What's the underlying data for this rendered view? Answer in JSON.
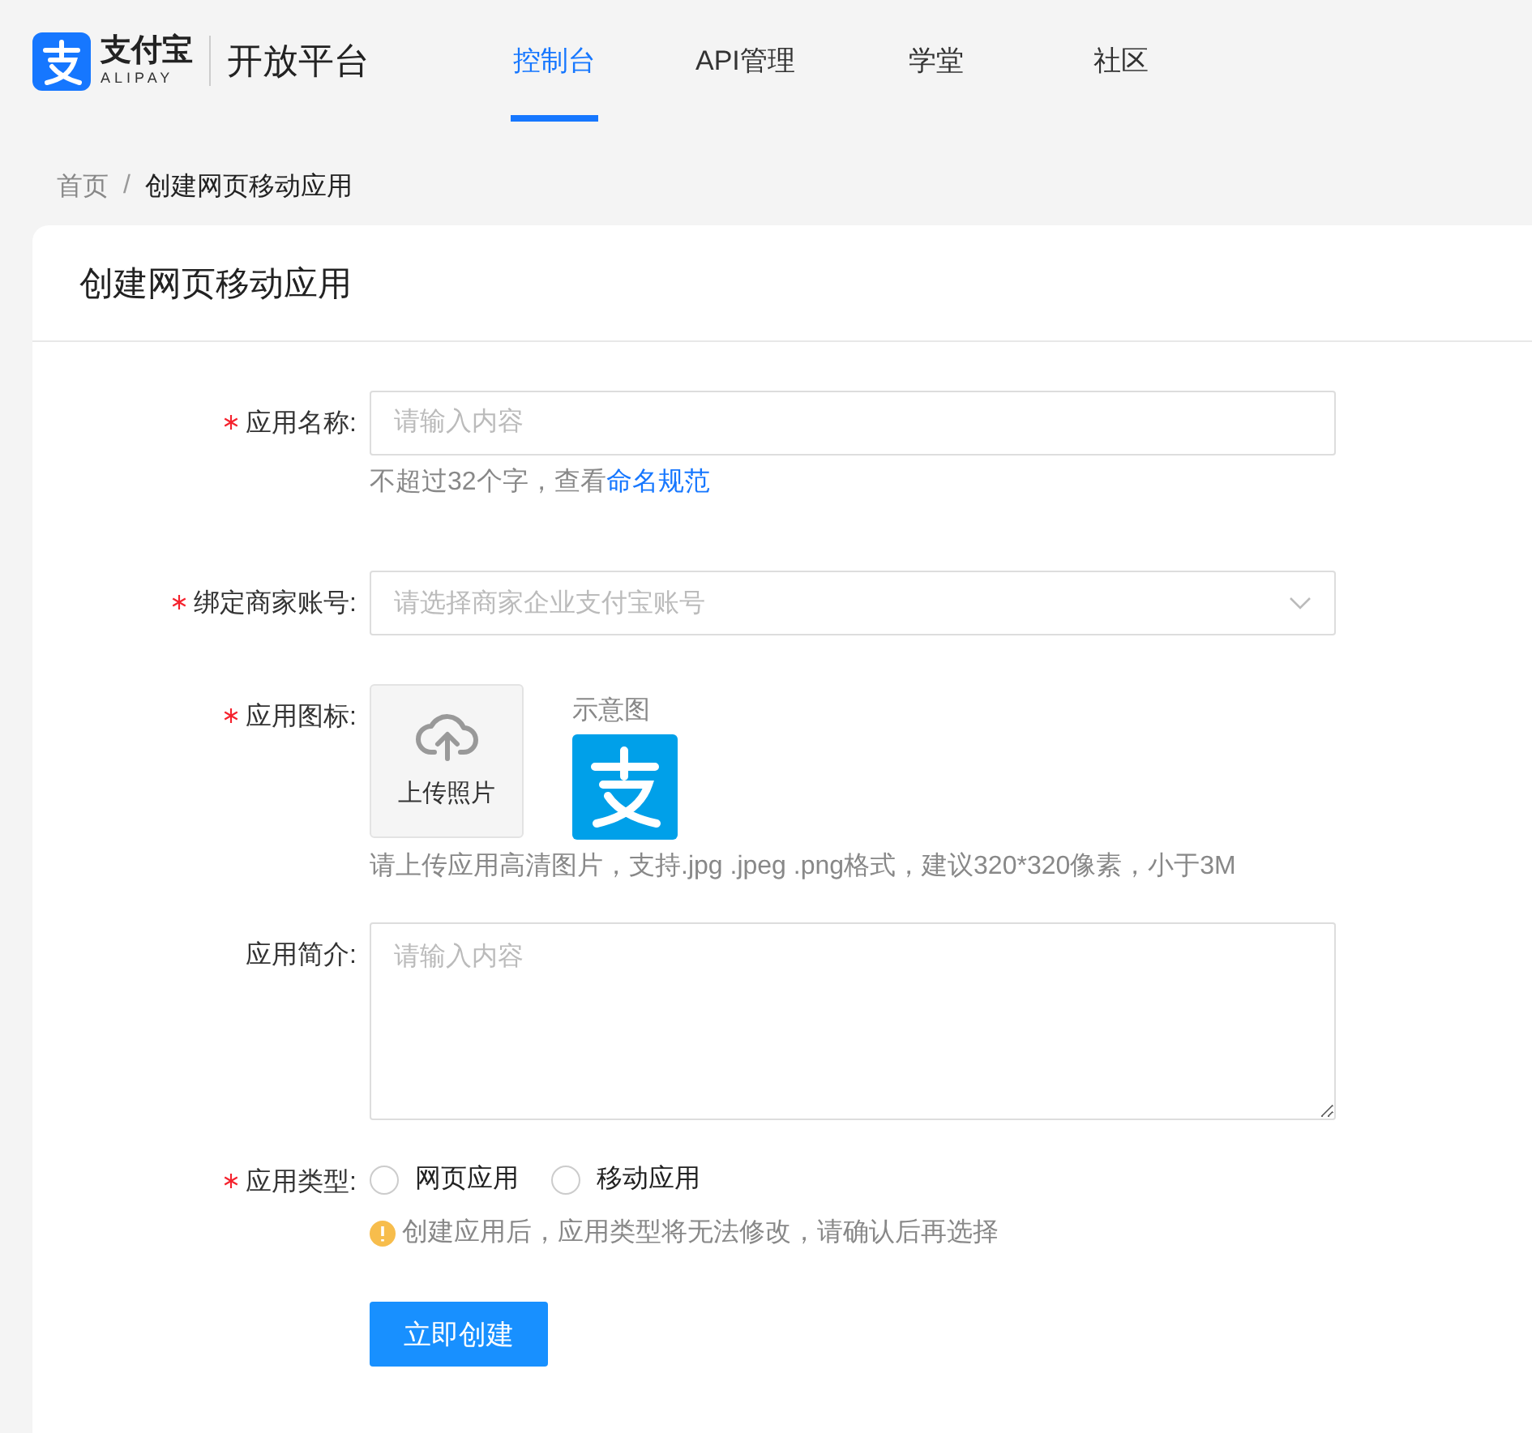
{
  "header": {
    "brand": "支付宝",
    "brand_sub": "ALIPAY",
    "product": "开放平台",
    "nav": [
      {
        "label": "控制台",
        "selected": true
      },
      {
        "label": "API管理",
        "selected": false
      },
      {
        "label": "学堂",
        "selected": false
      },
      {
        "label": "社区",
        "selected": false
      }
    ]
  },
  "breadcrumb": [
    {
      "label": "首页",
      "current": false
    },
    {
      "label": "创建网页移动应用",
      "current": true
    }
  ],
  "breadcrumb_separator": "/",
  "card": {
    "title": "创建网页移动应用",
    "fields": [
      {
        "kind": "input",
        "label": "应用名称:",
        "required": true,
        "placeholder": "请输入内容",
        "hint": "不超过32个字，查看",
        "hint_link": "命名规范"
      },
      {
        "kind": "select",
        "label": "绑定商家账号:",
        "required": true,
        "placeholder": "请选择商家企业支付宝账号"
      },
      {
        "kind": "upload",
        "label": "应用图标:",
        "required": true,
        "upload_label": "上传照片",
        "sample_label": "示意图",
        "hint": "请上传应用高清图片，支持.jpg .jpeg .png格式，建议320*320像素，小于3M"
      },
      {
        "kind": "textarea",
        "label": "应用简介:",
        "required": false,
        "placeholder": "请输入内容"
      },
      {
        "kind": "radio",
        "label": "应用类型:",
        "required": true,
        "options": [
          {
            "label": "网页应用",
            "selected": false
          },
          {
            "label": "移动应用",
            "selected": false
          }
        ],
        "warning": "创建应用后，应用类型将无法修改，请确认后再选择"
      }
    ],
    "submit": "立即创建"
  }
}
